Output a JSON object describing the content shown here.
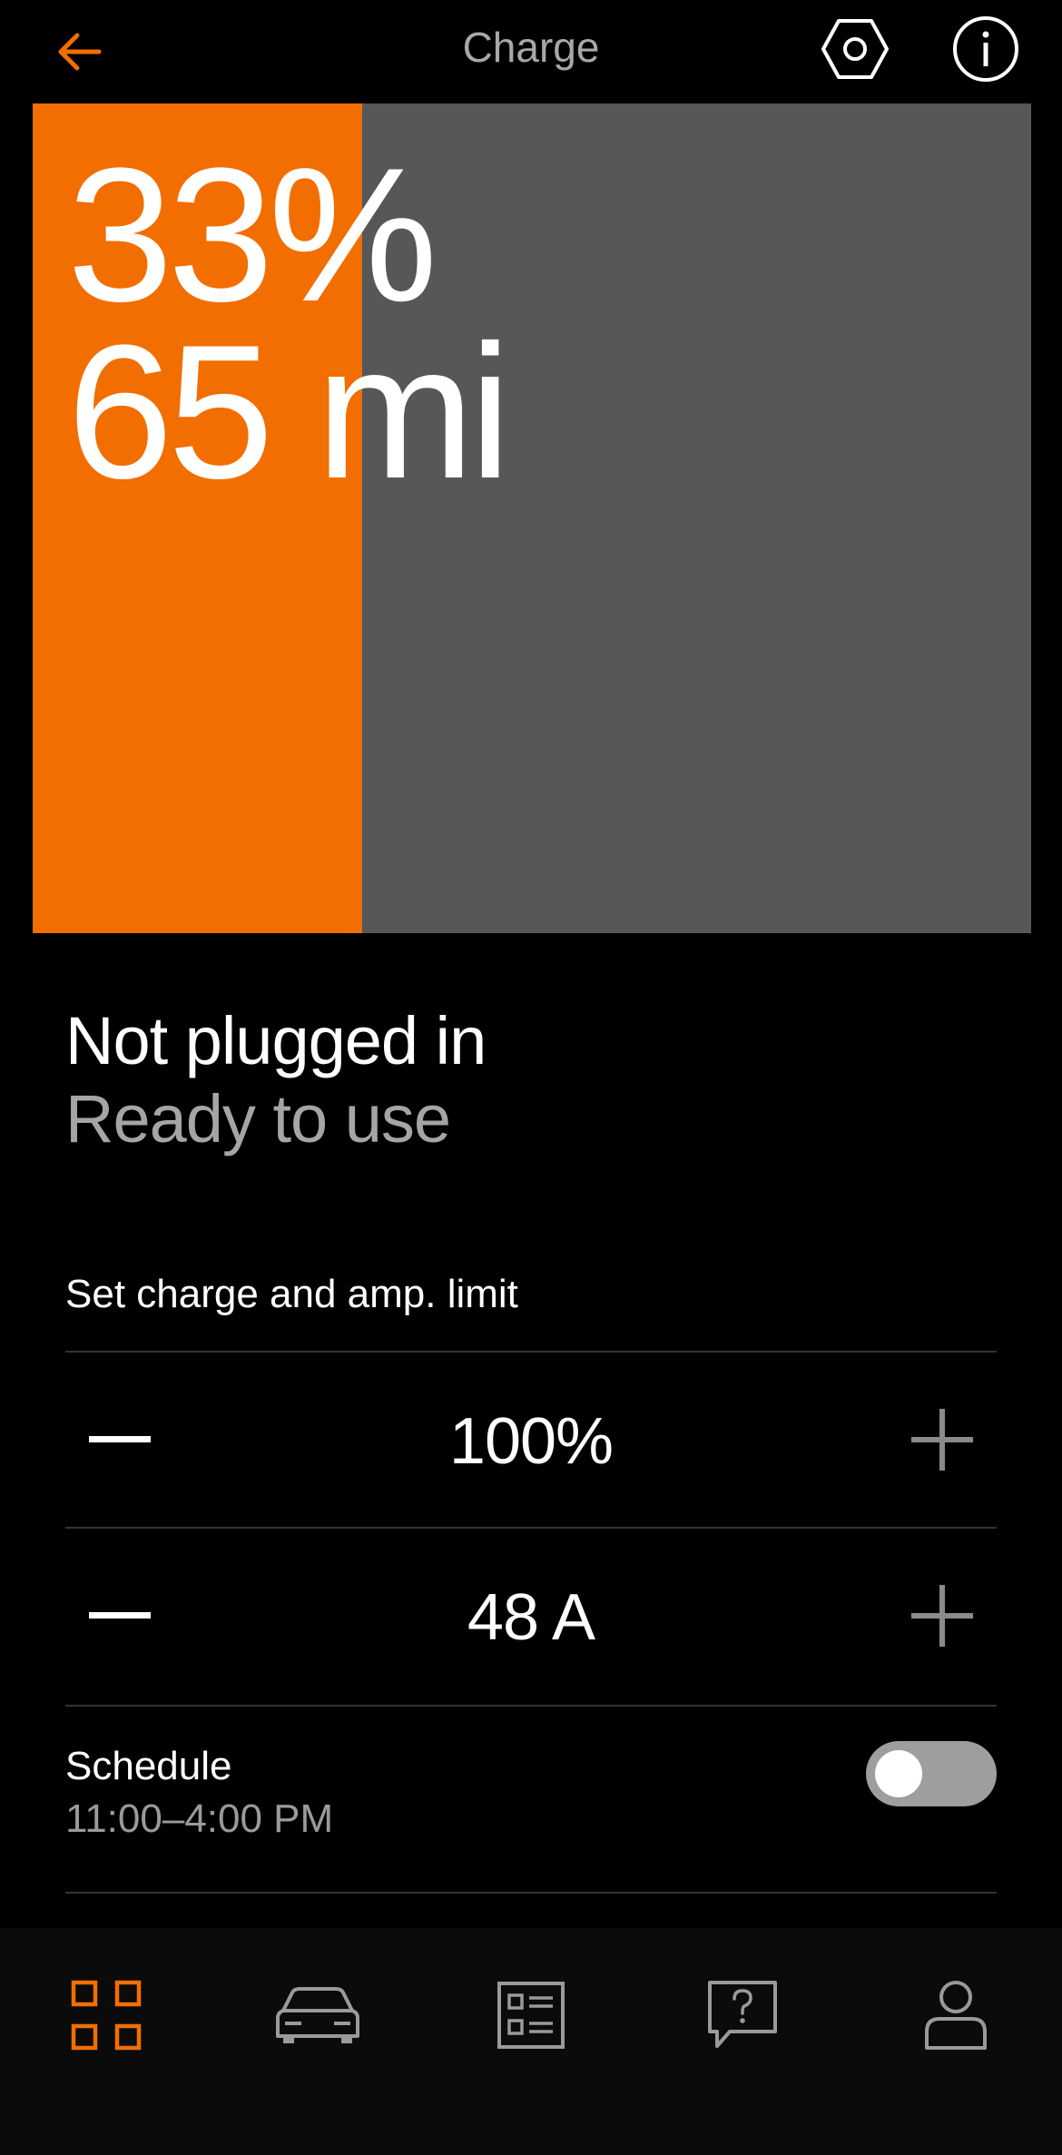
{
  "header": {
    "title": "Charge",
    "back_icon": "arrow-left-icon",
    "settings_icon": "hex-settings-icon",
    "info_icon": "info-icon"
  },
  "battery": {
    "percent_label": "33%",
    "level": 0.33,
    "range_label": "65 mi"
  },
  "status": {
    "primary": "Not plugged in",
    "secondary": "Ready to use"
  },
  "limits": {
    "title": "Set charge and amp. limit",
    "charge_limit": "100%",
    "amp_limit": "48 A"
  },
  "schedule": {
    "label": "Schedule",
    "time": "11:00–4:00 PM",
    "enabled": false
  },
  "nav": {
    "items": [
      {
        "icon": "grid-icon",
        "active": true
      },
      {
        "icon": "car-icon",
        "active": false
      },
      {
        "icon": "list-icon",
        "active": false
      },
      {
        "icon": "help-chat-icon",
        "active": false
      },
      {
        "icon": "profile-icon",
        "active": false
      }
    ]
  },
  "colors": {
    "accent": "#f26e00",
    "battery_empty": "#555759",
    "background": "#000000",
    "nav_background": "#0b0b0b",
    "secondary_text": "#a5a5a5",
    "toggle_off": "#9e9e9e"
  }
}
